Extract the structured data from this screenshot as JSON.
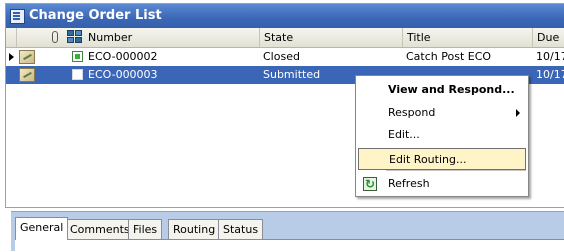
{
  "window": {
    "title": "Change Order List",
    "title_icon": "list-window-icon"
  },
  "columns": {
    "attachment_icon": "paperclip-icon",
    "type_icon": "grid-icon",
    "number": "Number",
    "state": "State",
    "title": "Title",
    "due": "Due"
  },
  "rows": [
    {
      "number": "ECO-000002",
      "state": "Closed",
      "title": "Catch Post ECO",
      "due": "10/17",
      "status_marker": "green",
      "selected": false
    },
    {
      "number": "ECO-000003",
      "state": "Submitted",
      "title": "",
      "due": "10/17",
      "status_marker": "white",
      "selected": true
    }
  ],
  "context_menu": {
    "items": [
      {
        "label": "View and Respond...",
        "bold": true
      },
      {
        "label": "Respond",
        "submenu": true
      },
      {
        "label": "Edit..."
      },
      {
        "label": "Edit Routing...",
        "highlighted": true
      },
      {
        "label": "Refresh",
        "icon": "refresh-icon"
      }
    ]
  },
  "tabs": [
    "General",
    "Comments",
    "Files",
    "Routing",
    "Status"
  ],
  "active_tab": "General",
  "colors": {
    "titlebar": "#3b67b6",
    "selection": "#3b66b8",
    "menu_highlight": "#fff3c8",
    "tab_panel": "#b9cce7"
  }
}
